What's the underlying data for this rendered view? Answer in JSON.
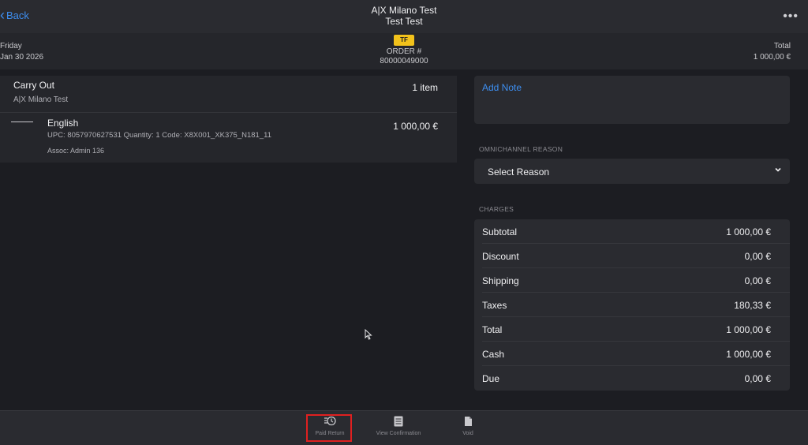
{
  "header": {
    "back_label": "Back",
    "store_name": "A|X Milano Test",
    "customer_name": "Test Test",
    "more_icon": "more-horizontal-icon"
  },
  "info": {
    "day": "Friday",
    "date": "Jan 30 2026",
    "badge": "TF",
    "order_label": "ORDER #",
    "order_number": "80000049000",
    "total_label": "Total",
    "total_value": "1 000,00 €"
  },
  "order": {
    "type": "Carry Out",
    "store": "A|X Milano Test",
    "item_count": "1 item",
    "items": [
      {
        "name": "English",
        "details": "UPC: 8057970627531 Quantity: 1 Code: X8X001_XK375_N181_11",
        "assoc": "Assoc: Admin 136",
        "price": "1 000,00 €"
      }
    ]
  },
  "note": {
    "add_label": "Add Note"
  },
  "reason": {
    "section_label": "OMNICHANNEL REASON",
    "select_label": "Select Reason"
  },
  "charges": {
    "section_label": "CHARGES",
    "rows": [
      {
        "label": "Subtotal",
        "value": "1 000,00 €"
      },
      {
        "label": "Discount",
        "value": "0,00 €"
      },
      {
        "label": "Shipping",
        "value": "0,00 €"
      },
      {
        "label": "Taxes",
        "value": "180,33 €"
      },
      {
        "label": "Total",
        "value": "1 000,00 €"
      },
      {
        "label": "Cash",
        "value": "1 000,00 €"
      },
      {
        "label": "Due",
        "value": "0,00 €"
      }
    ]
  },
  "toolbar": {
    "buttons": [
      {
        "label": "Paid Return",
        "icon": "paid-return-icon"
      },
      {
        "label": "View Confirmation",
        "icon": "document-icon"
      },
      {
        "label": "Void",
        "icon": "void-document-icon"
      }
    ]
  },
  "colors": {
    "accent": "#3d8ef0",
    "badge": "#f2c21b",
    "highlight": "#e02020"
  }
}
